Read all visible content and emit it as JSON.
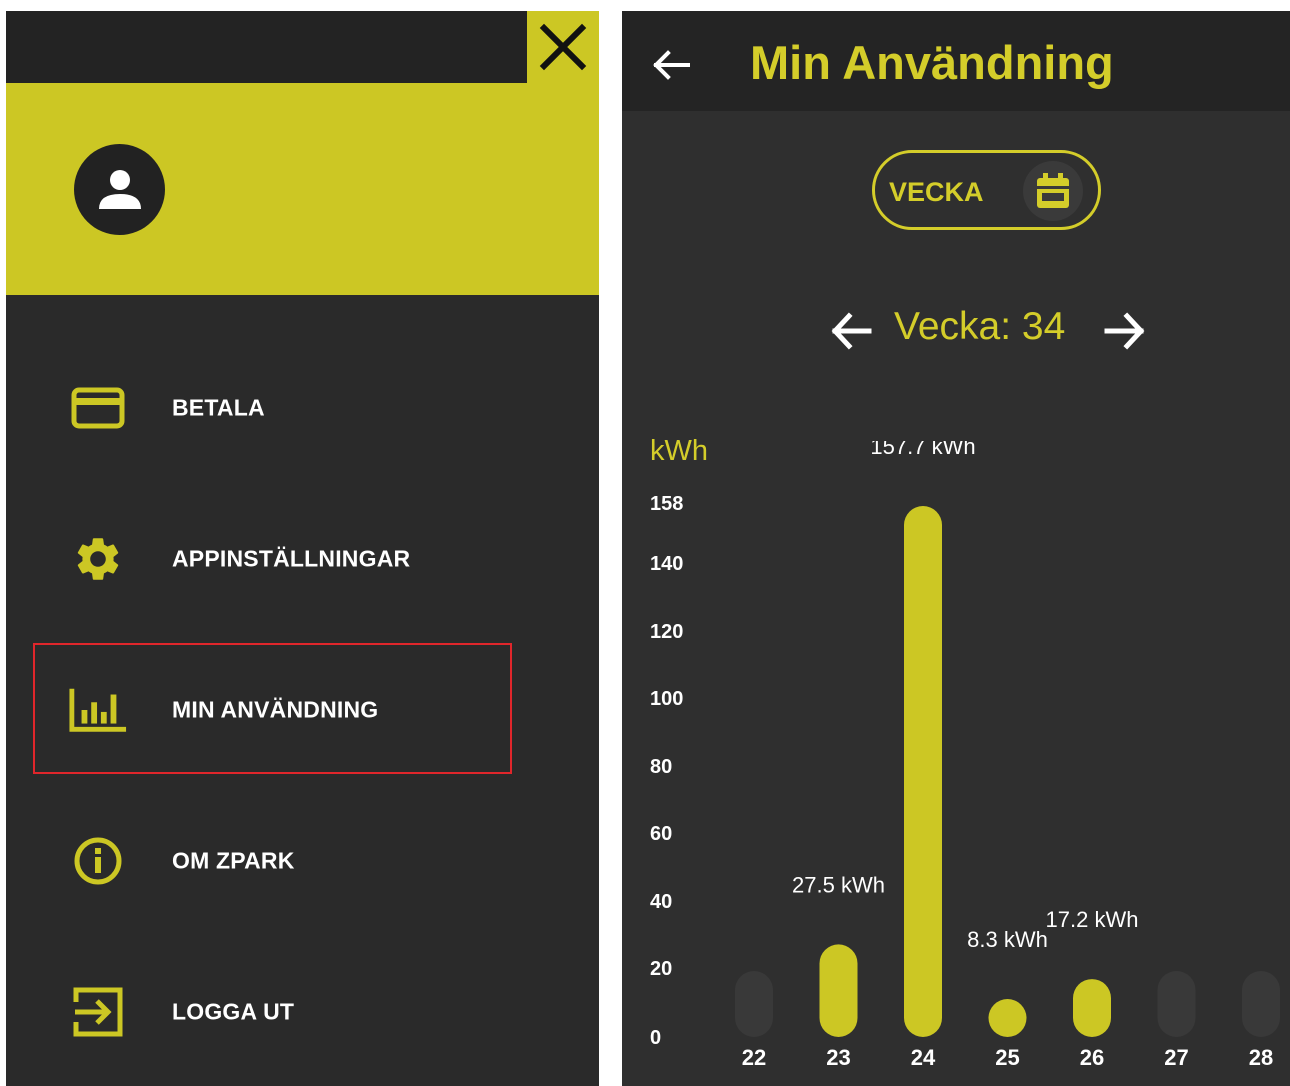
{
  "drawer": {
    "menu": [
      {
        "label": "BETALA",
        "icon": "credit-card-icon"
      },
      {
        "label": "APPINSTÄLLNINGAR",
        "icon": "gear-icon"
      },
      {
        "label": "MIN ANVÄNDNING",
        "icon": "bar-chart-icon"
      },
      {
        "label": "OM ZPARK",
        "icon": "info-icon"
      },
      {
        "label": "LOGGA UT",
        "icon": "logout-icon"
      }
    ],
    "accent_color": "#ccc724"
  },
  "usage": {
    "title": "Min Användning",
    "toggle_label": "VECKA",
    "week_label": "Vecka: 34",
    "unit": "kWh"
  },
  "chart_data": {
    "type": "bar",
    "categories": [
      "22",
      "23",
      "24",
      "25",
      "26",
      "27",
      "28"
    ],
    "values": [
      0,
      27.5,
      157.7,
      8.3,
      17.2,
      0,
      0
    ],
    "data_labels": [
      "",
      "27.5 kWh",
      "157.7 kWh",
      "8.3 kWh",
      "17.2 kWh",
      "",
      ""
    ],
    "yticks": [
      "158",
      "140",
      "120",
      "100",
      "80",
      "60",
      "40",
      "20",
      "0"
    ],
    "ylabel": "kWh",
    "ylim": [
      0,
      158
    ],
    "bar_color": "#ccc724"
  }
}
